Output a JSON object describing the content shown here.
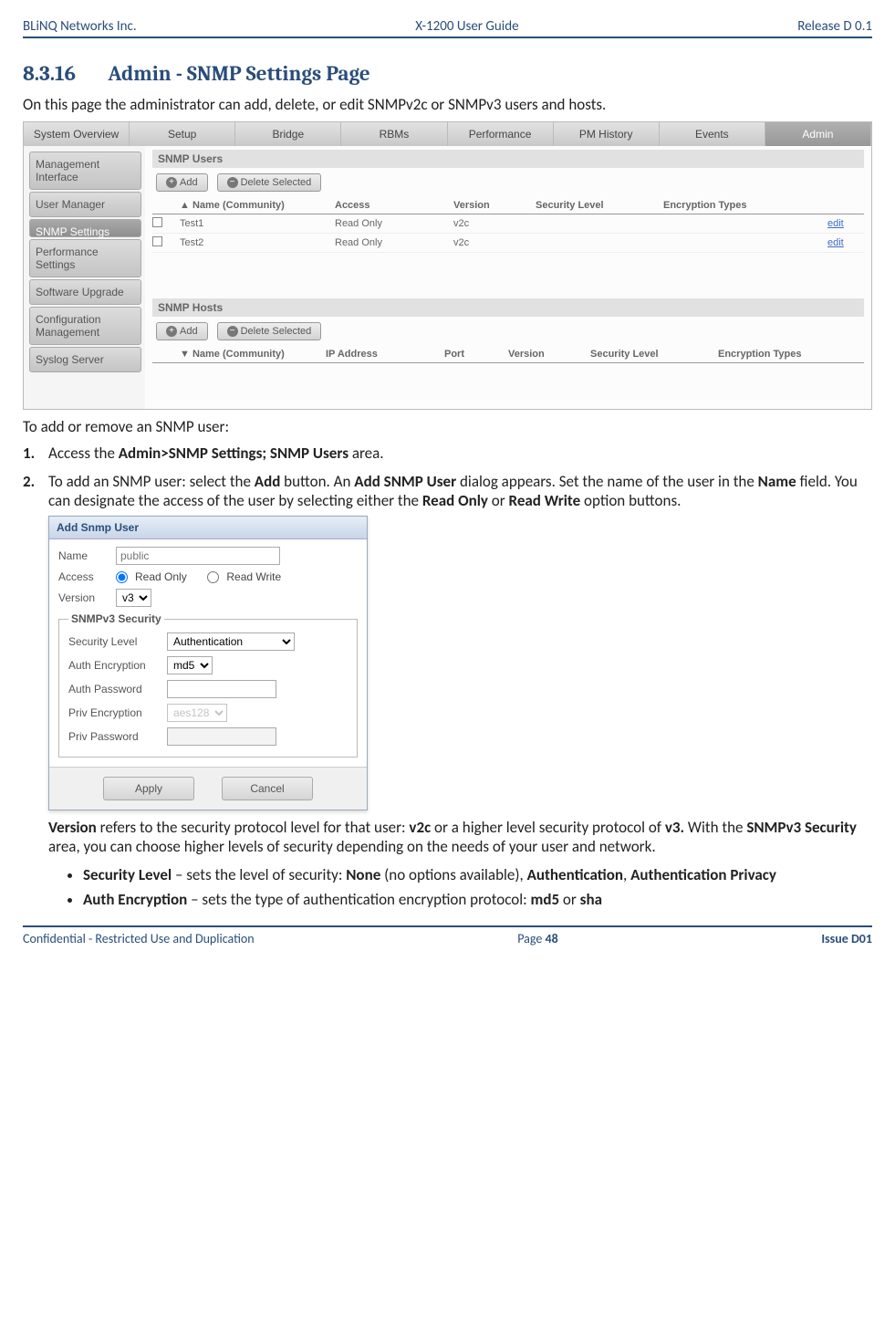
{
  "header": {
    "left": "BLiNQ Networks Inc.",
    "center": "X-1200 User Guide",
    "right": "Release D 0.1"
  },
  "section": {
    "number": "8.3.16",
    "title": "Admin - SNMP Settings Page"
  },
  "intro": "On this page the administrator can add, delete, or edit SNMPv2c or SNMPv3 users and hosts.",
  "shot1": {
    "tabs": [
      "System Overview",
      "Setup",
      "Bridge",
      "RBMs",
      "Performance",
      "PM History",
      "Events",
      "Admin"
    ],
    "side": [
      "Management Interface",
      "User Manager",
      "SNMP Settings",
      "Performance Settings",
      "Software Upgrade",
      "Configuration Management",
      "Syslog Server"
    ],
    "users_title": "SNMP Users",
    "hosts_title": "SNMP Hosts",
    "add": "Add",
    "del": "Delete Selected",
    "uhead": {
      "name": "Name (Community)",
      "access": "Access",
      "ver": "Version",
      "sec": "Security Level",
      "enc": "Encryption Types"
    },
    "urows": [
      {
        "name": "Test1",
        "access": "Read Only",
        "ver": "v2c",
        "edit": "edit"
      },
      {
        "name": "Test2",
        "access": "Read Only",
        "ver": "v2c",
        "edit": "edit"
      }
    ],
    "hhead": {
      "name": "Name (Community)",
      "ip": "IP Address",
      "port": "Port",
      "ver": "Version",
      "sec": "Security Level",
      "enc": "Encryption Types"
    }
  },
  "subhead": "To add or remove an SNMP user:",
  "steps": {
    "s1a": "Access the ",
    "s1b": "Admin>SNMP Settings; SNMP Users",
    "s1c": " area.",
    "s2a": "To add an SNMP user: select the ",
    "s2b": "Add",
    "s2c": " button. An ",
    "s2d": "Add SNMP User",
    "s2e": " dialog appears. Set the name of the user in the ",
    "s2f": "Name",
    "s2g": " field. You can designate the access of the user by selecting either the ",
    "s2h": "Read Only",
    "s2i": " or ",
    "s2j": "Read Write",
    "s2k": " option buttons."
  },
  "dialog": {
    "title": "Add Snmp User",
    "name_l": "Name",
    "name_ph": "public",
    "access_l": "Access",
    "ro": "Read Only",
    "rw": "Read Write",
    "ver_l": "Version",
    "ver_v": "v3",
    "fs": "SNMPv3 Security",
    "seclvl_l": "Security Level",
    "seclvl_v": "Authentication",
    "authenc_l": "Auth Encryption",
    "authenc_v": "md5",
    "authpw_l": "Auth Password",
    "privenc_l": "Priv Encryption",
    "privenc_v": "aes128",
    "privpw_l": "Priv Password",
    "apply": "Apply",
    "cancel": "Cancel"
  },
  "para2": {
    "a": "Version",
    "b": " refers to the security protocol level for that user: ",
    "c": "v2c",
    "d": " or a higher level security protocol of ",
    "e": "v3.",
    "f": " With the ",
    "g": "SNMPv3 Security",
    "h": " area, you can choose higher levels of security depending on the needs of your user and network."
  },
  "bul": {
    "b1a": "Security Level",
    "b1b": " – sets the level of security: ",
    "b1c": "None",
    "b1d": " (no options available), ",
    "b1e": "Authentication",
    "b1f": ", ",
    "b1g": "Authentication Privacy",
    "b2a": "Auth Encryption",
    "b2b": " – sets the type of authentication encryption protocol: ",
    "b2c": "md5",
    "b2d": " or ",
    "b2e": "sha"
  },
  "footer": {
    "left": "Confidential - Restricted Use and Duplication",
    "pg_pre": "Page ",
    "pg": "48",
    "right": "Issue D01"
  }
}
